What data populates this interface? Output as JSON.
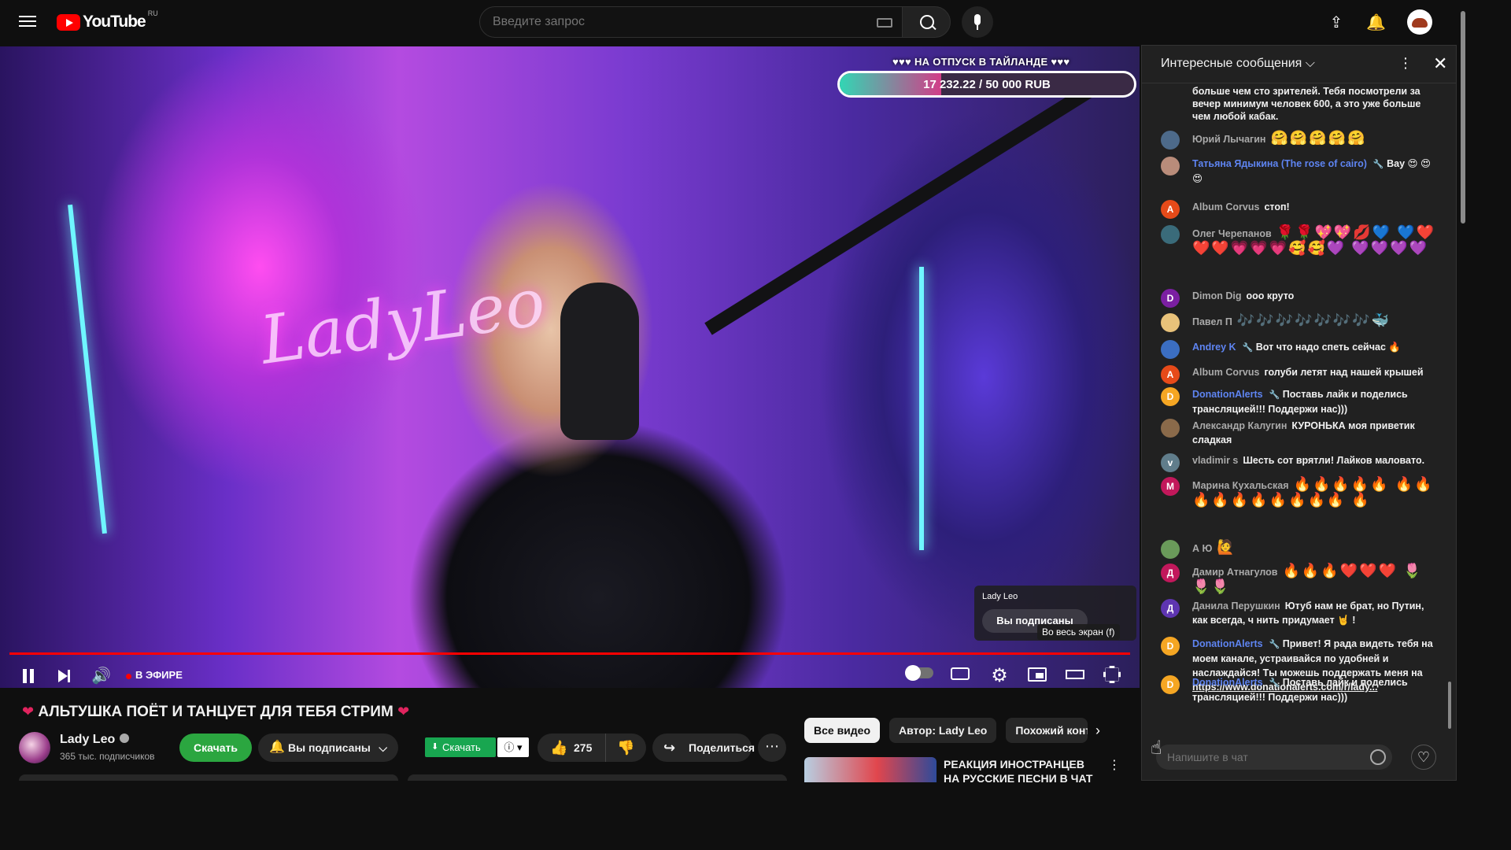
{
  "header": {
    "logo_text": "YouTube",
    "logo_region": "RU",
    "search_placeholder": "Введите запрос"
  },
  "player": {
    "neon_sign": "LadyLeo",
    "donation_goal_title": "♥♥♥ НА ОТПУСК В ТАЙЛАНДЕ ♥♥♥",
    "donation_amount": "17 232.22 / 50 000 RUB",
    "donation_progress": 0.3446,
    "overlay_channel": "Lady Leo",
    "overlay_subscribe": "Вы подписаны",
    "tooltip": "Во весь экран (f)",
    "live_label": "В ЭФИРЕ"
  },
  "video": {
    "title": "АЛЬТУШКА ПОЁТ И ТАНЦУЕТ ДЛЯ ТЕБЯ СТРИМ",
    "channel_name": "Lady Leo",
    "subscribers": "365 тыс. подписчиков",
    "download_label": "Скачать",
    "subscribed_label": "Вы подписаны",
    "ext_download_label": "Скачать",
    "ext_info_label": "ⓘ ▾",
    "likes": "275",
    "share_label": "Поделиться"
  },
  "related": {
    "chips": [
      "Все видео",
      "Автор: Lady Leo",
      "Похожий конте"
    ],
    "first_title": "РЕАКЦИЯ ИНОСТРАНЦЕВ НА РУССКИЕ ПЕСНИ В ЧАТ"
  },
  "chat": {
    "header_title": "Интересные сообщения ⌵",
    "top_text": "больше чем сто зрителей. Тебя посмотрели за вечер минимум человек 600, а это уже больше чем любой кабак.",
    "input_placeholder": "Напишите в чат",
    "messages": [
      {
        "initial": "",
        "author": "Юрий Лычагин",
        "text": "🤗🤗🤗🤗🤗",
        "color": "#4d6a8a",
        "mod": false
      },
      {
        "initial": "",
        "author": "Татьяна Ядыкина (The rose of cairo)",
        "text": "Вау 😍 😍😍",
        "color": "#b98c7a",
        "mod": true
      },
      {
        "initial": "A",
        "author": "Album Corvus",
        "text": "стоп!",
        "color": "#e64a19",
        "mod": false
      },
      {
        "initial": "",
        "author": "Олег Черепанов",
        "text": "🌹🌹💖💖💋💙 💙❤️❤️❤️💗💗💗🥰🥰💜 💜💜💜💜",
        "color": "#3a6b7a",
        "mod": false
      },
      {
        "initial": "D",
        "author": "Dimon Dig",
        "text": "ооо круто",
        "color": "#7b1fa2",
        "mod": false
      },
      {
        "initial": "",
        "author": "Павел П",
        "text": "🎶🎶🎶🎶🎶🎶🎶🐳",
        "color": "#e8c27a",
        "mod": false
      },
      {
        "initial": "",
        "author": "Andrey K",
        "text": "Вот что надо спеть сейчас 🔥",
        "color": "#3b6ec2",
        "mod": true
      },
      {
        "initial": "A",
        "author": "Album Corvus",
        "text": "голуби летят над нашей крышей",
        "color": "#e64a19",
        "mod": false
      },
      {
        "initial": "D",
        "author": "DonationAlerts",
        "text": "Поставь лайк и поделись трансляцией!!! Поддержи нас)))",
        "color": "#f5a623",
        "mod": true
      },
      {
        "initial": "",
        "author": "Александр Калугин",
        "text": "КУРОНЬКА моя приветик сладкая",
        "color": "#8a6a4a",
        "mod": false
      },
      {
        "initial": "v",
        "author": "vladimir s",
        "text": "Шесть сот врятли! Лайков маловато.",
        "color": "#607d8b",
        "mod": false
      },
      {
        "initial": "М",
        "author": "Марина Кухальская",
        "text": "🔥🔥🔥🔥🔥 🔥🔥🔥🔥🔥🔥🔥🔥🔥🔥 🔥",
        "color": "#c2185b",
        "mod": false
      },
      {
        "initial": "",
        "author": "А Ю",
        "text": "🙋",
        "color": "#6a9a5a",
        "mod": false
      },
      {
        "initial": "Д",
        "author": "Дамир Атнагулов",
        "text": "🔥🔥🔥❤️❤️❤️ 🌷🌷🌷",
        "color": "#c2185b",
        "mod": false
      },
      {
        "initial": "Д",
        "author": "Данила Перушкин",
        "text": "Ютуб нам не брат, но Путин, как всегда, ч нить придумает 🤘 !",
        "color": "#5e35b1",
        "mod": false
      },
      {
        "initial": "D",
        "author": "DonationAlerts",
        "text": "Привет! Я рада видеть тебя на моем канале, устраивайся по удобней и наслаждайся! Ты можешь поддержать меня на",
        "link": "https://www.donationalerts.com/r/lady...",
        "color": "#f5a623",
        "mod": true
      },
      {
        "initial": "D",
        "author": "DonationAlerts",
        "text": "Поставь лайк и поделись трансляцией!!! Поддержи нас)))",
        "color": "#f5a623",
        "mod": true
      }
    ]
  }
}
